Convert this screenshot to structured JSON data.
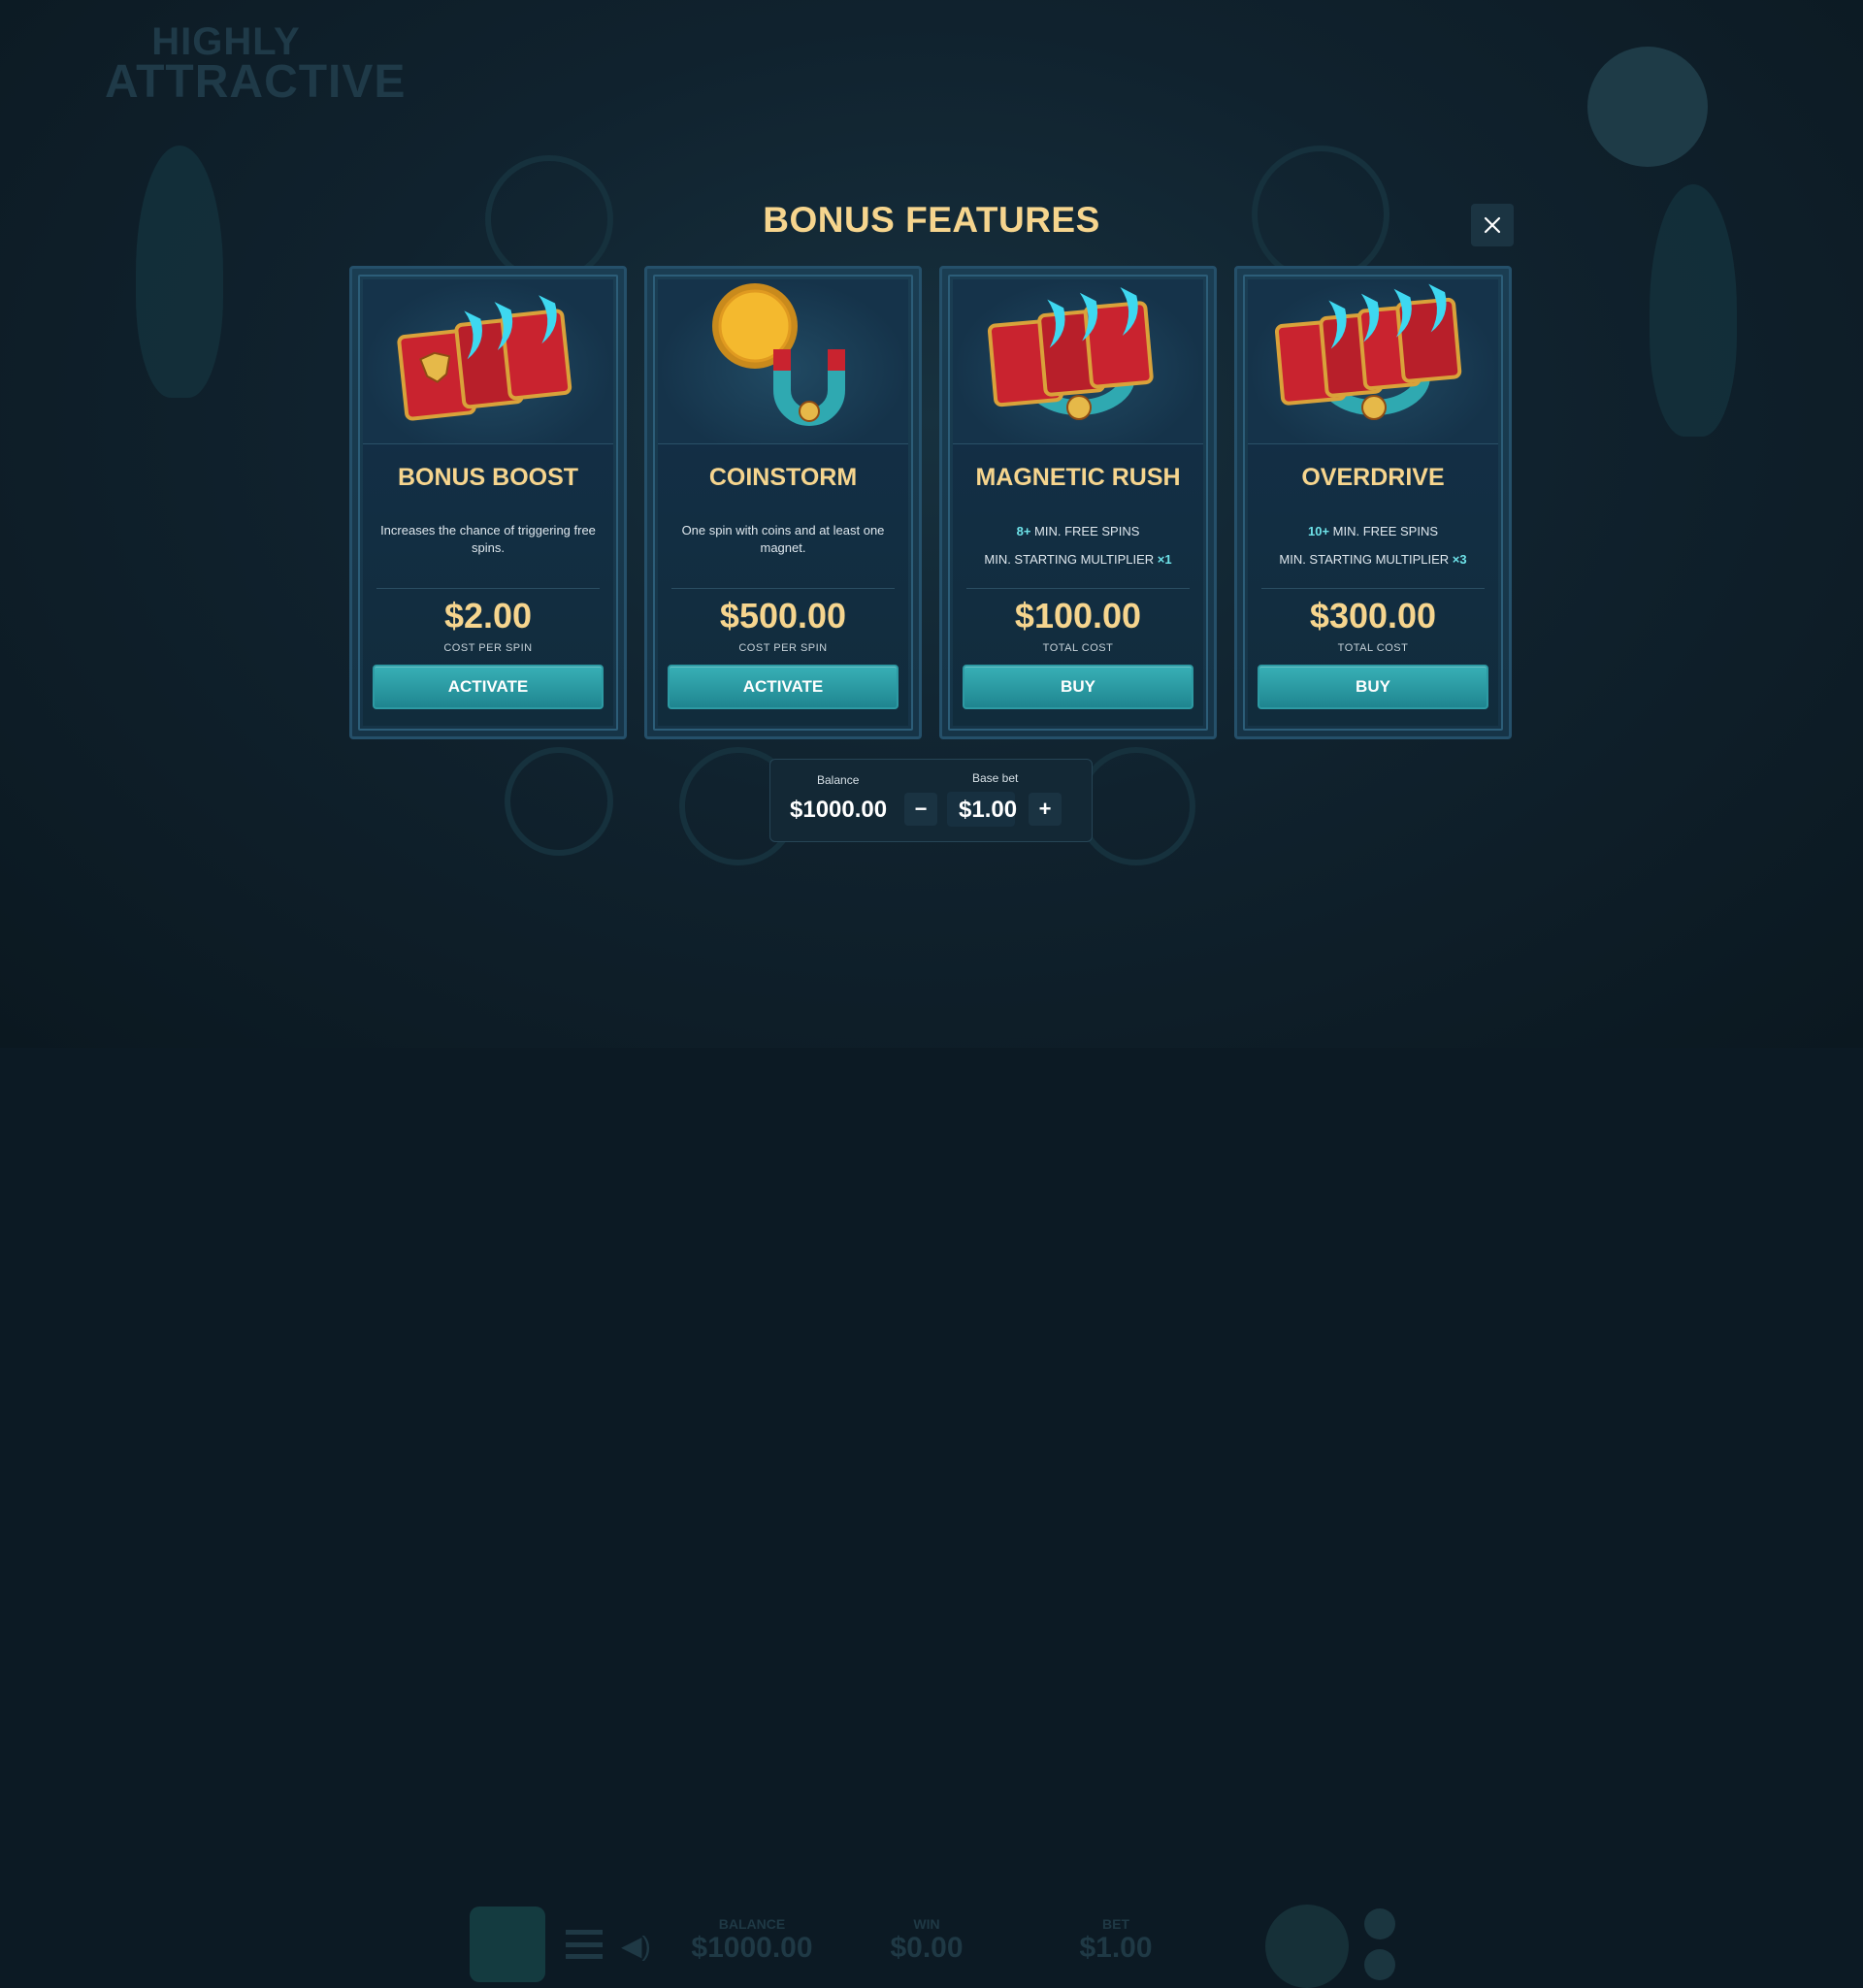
{
  "background": {
    "logo_line1": "HIGHLY",
    "logo_line2": "ATTRACTIVE",
    "stats": [
      {
        "label": "BALANCE",
        "value": "$1000.00"
      },
      {
        "label": "WIN",
        "value": "$0.00"
      },
      {
        "label": "BET",
        "value": "$1.00"
      }
    ]
  },
  "modal": {
    "title": "BONUS FEATURES",
    "close_icon": "close-icon"
  },
  "cards": [
    {
      "name": "BONUS BOOST",
      "description": "Increases the chance of triggering free spins.",
      "price": "$2.00",
      "cost_label": "COST PER SPIN",
      "button": "ACTIVATE",
      "art": "spell-books-icon"
    },
    {
      "name": "COINSTORM",
      "description": "One spin with coins and at least one magnet.",
      "price": "$500.00",
      "cost_label": "COST PER SPIN",
      "button": "ACTIVATE",
      "art": "coin-magnet-icon"
    },
    {
      "name": "MAGNETIC RUSH",
      "line1_highlight": "8+",
      "line1_text": " MIN. FREE SPINS",
      "line2_text": "MIN. STARTING MULTIPLIER ",
      "line2_highlight": "×1",
      "price": "$100.00",
      "cost_label": "TOTAL COST",
      "button": "BUY",
      "art": "books-magnet-icon"
    },
    {
      "name": "OVERDRIVE",
      "line1_highlight": "10+",
      "line1_text": " MIN. FREE SPINS",
      "line2_text": "MIN. STARTING MULTIPLIER ",
      "line2_highlight": "×3",
      "price": "$300.00",
      "cost_label": "TOTAL COST",
      "button": "BUY",
      "art": "books-magnet-icon"
    }
  ],
  "panel": {
    "balance_label": "Balance",
    "balance_value": "$1000.00",
    "bet_label": "Base bet",
    "bet_value": "$1.00",
    "minus": "−",
    "plus": "+"
  },
  "colors": {
    "accent_gold": "#f6d58e",
    "button_teal": "#2a9ea6",
    "highlight_cyan": "#6ee3e9"
  }
}
